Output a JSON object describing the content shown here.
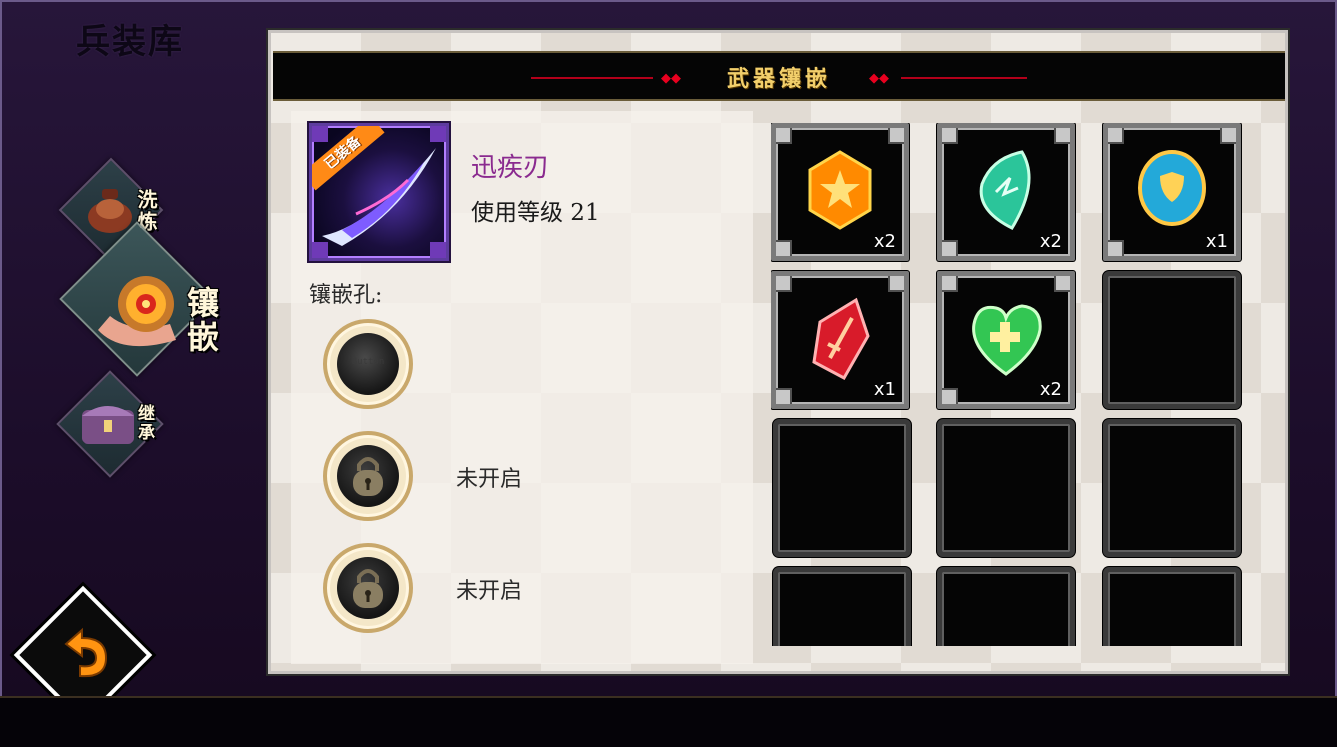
{
  "app": {
    "title": "兵装库"
  },
  "side_tabs": [
    {
      "label": "洗炼",
      "state": "inactive",
      "icon": "wash-pot-icon"
    },
    {
      "label": "镶嵌",
      "state": "active",
      "icon": "inlay-wheel-icon"
    },
    {
      "label": "继承",
      "state": "inactive",
      "icon": "treasure-chest-icon"
    }
  ],
  "back_button": {
    "icon": "back-arrow-icon",
    "ghost_text": "Button"
  },
  "panel": {
    "title": "武器镶嵌",
    "weapon": {
      "name": "迅疾刃",
      "level_text": "使用等级 21",
      "badge": "已装备",
      "icon": "blade-weapon-icon"
    },
    "slots_label": "镶嵌孔:",
    "sockets": [
      {
        "state": "open",
        "ghost_text": "Button",
        "status": ""
      },
      {
        "state": "locked",
        "status": "未开启"
      },
      {
        "state": "locked",
        "status": "未开启"
      }
    ],
    "gems": [
      {
        "icon": "orange-star-gem-icon",
        "color": "#ff8a00",
        "count": "x2"
      },
      {
        "icon": "green-crystal-gem-icon",
        "color": "#2bc59a",
        "count": "x2"
      },
      {
        "icon": "blue-shield-gem-icon",
        "color": "#23a9d9",
        "count": "x1"
      },
      {
        "icon": "red-sword-gem-icon",
        "color": "#d81b2a",
        "count": "x1"
      },
      {
        "icon": "green-heart-cross-gem-icon",
        "color": "#33c653",
        "count": "x2"
      },
      {
        "icon": "",
        "count": ""
      },
      {
        "icon": "",
        "count": ""
      },
      {
        "icon": "",
        "count": ""
      },
      {
        "icon": "",
        "count": ""
      },
      {
        "icon": "",
        "count": ""
      },
      {
        "icon": "",
        "count": ""
      },
      {
        "icon": "",
        "count": ""
      }
    ]
  },
  "colors": {
    "accent_red": "#e8001f",
    "title_gold": "#f2cf6b",
    "weapon_name": "#8a2a8f"
  }
}
